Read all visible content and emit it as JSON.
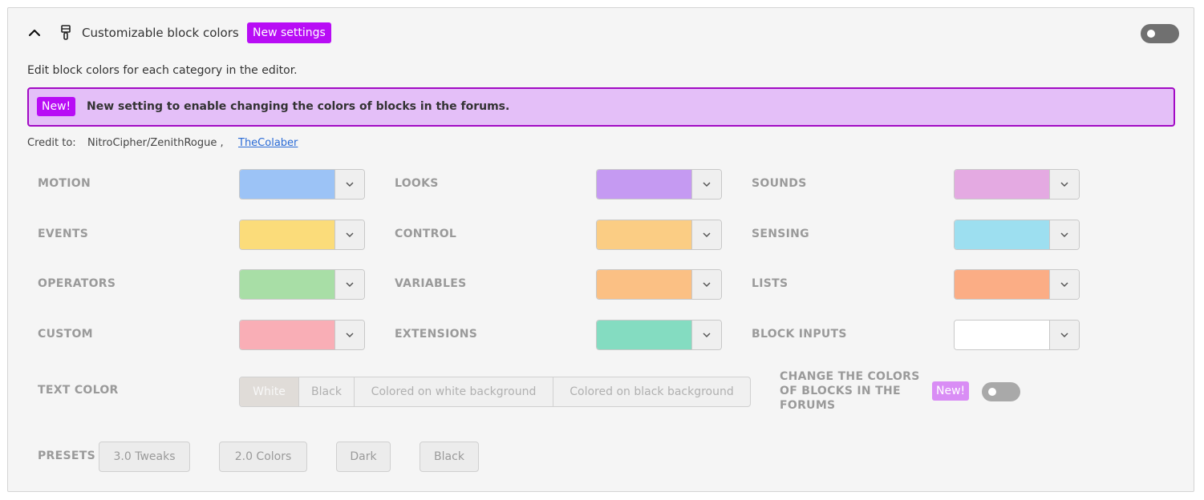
{
  "header": {
    "title": "Customizable block colors",
    "badge": "New settings",
    "enabled": false
  },
  "description": "Edit block colors for each category in the editor.",
  "notice": {
    "badge": "New!",
    "text": "New setting to enable changing the colors of blocks in the forums."
  },
  "credit": {
    "label": "Credit to:",
    "name": "NitroCipher/ZenithRogue ,",
    "link": "TheColaber"
  },
  "categories": [
    {
      "label": "MOTION",
      "color": "#9cc3f6"
    },
    {
      "label": "LOOKS",
      "color": "#c59af2"
    },
    {
      "label": "SOUNDS",
      "color": "#e4aae2"
    },
    {
      "label": "EVENTS",
      "color": "#fbdc7a"
    },
    {
      "label": "CONTROL",
      "color": "#fbcd84"
    },
    {
      "label": "SENSING",
      "color": "#9ddff0"
    },
    {
      "label": "OPERATORS",
      "color": "#a8dea6"
    },
    {
      "label": "VARIABLES",
      "color": "#fbc084"
    },
    {
      "label": "LISTS",
      "color": "#fbad85"
    },
    {
      "label": "CUSTOM",
      "color": "#f9aeb6"
    },
    {
      "label": "EXTENSIONS",
      "color": "#84dcc1"
    },
    {
      "label": "BLOCK INPUTS",
      "color": "#ffffff"
    }
  ],
  "text_color": {
    "label": "TEXT COLOR",
    "options": [
      "White",
      "Black",
      "Colored on white background",
      "Colored on black background"
    ],
    "selected": "White"
  },
  "forums": {
    "label": "CHANGE THE COLORS OF BLOCKS IN THE FORUMS",
    "badge": "New!",
    "enabled": false
  },
  "presets": {
    "label": "PRESETS",
    "buttons": [
      "3.0 Tweaks",
      "2.0 Colors",
      "Dark",
      "Black"
    ]
  },
  "icons": {
    "collapse": "chevron-up-icon",
    "addon": "paintbrush-icon",
    "dropdown": "chevron-down-icon"
  }
}
